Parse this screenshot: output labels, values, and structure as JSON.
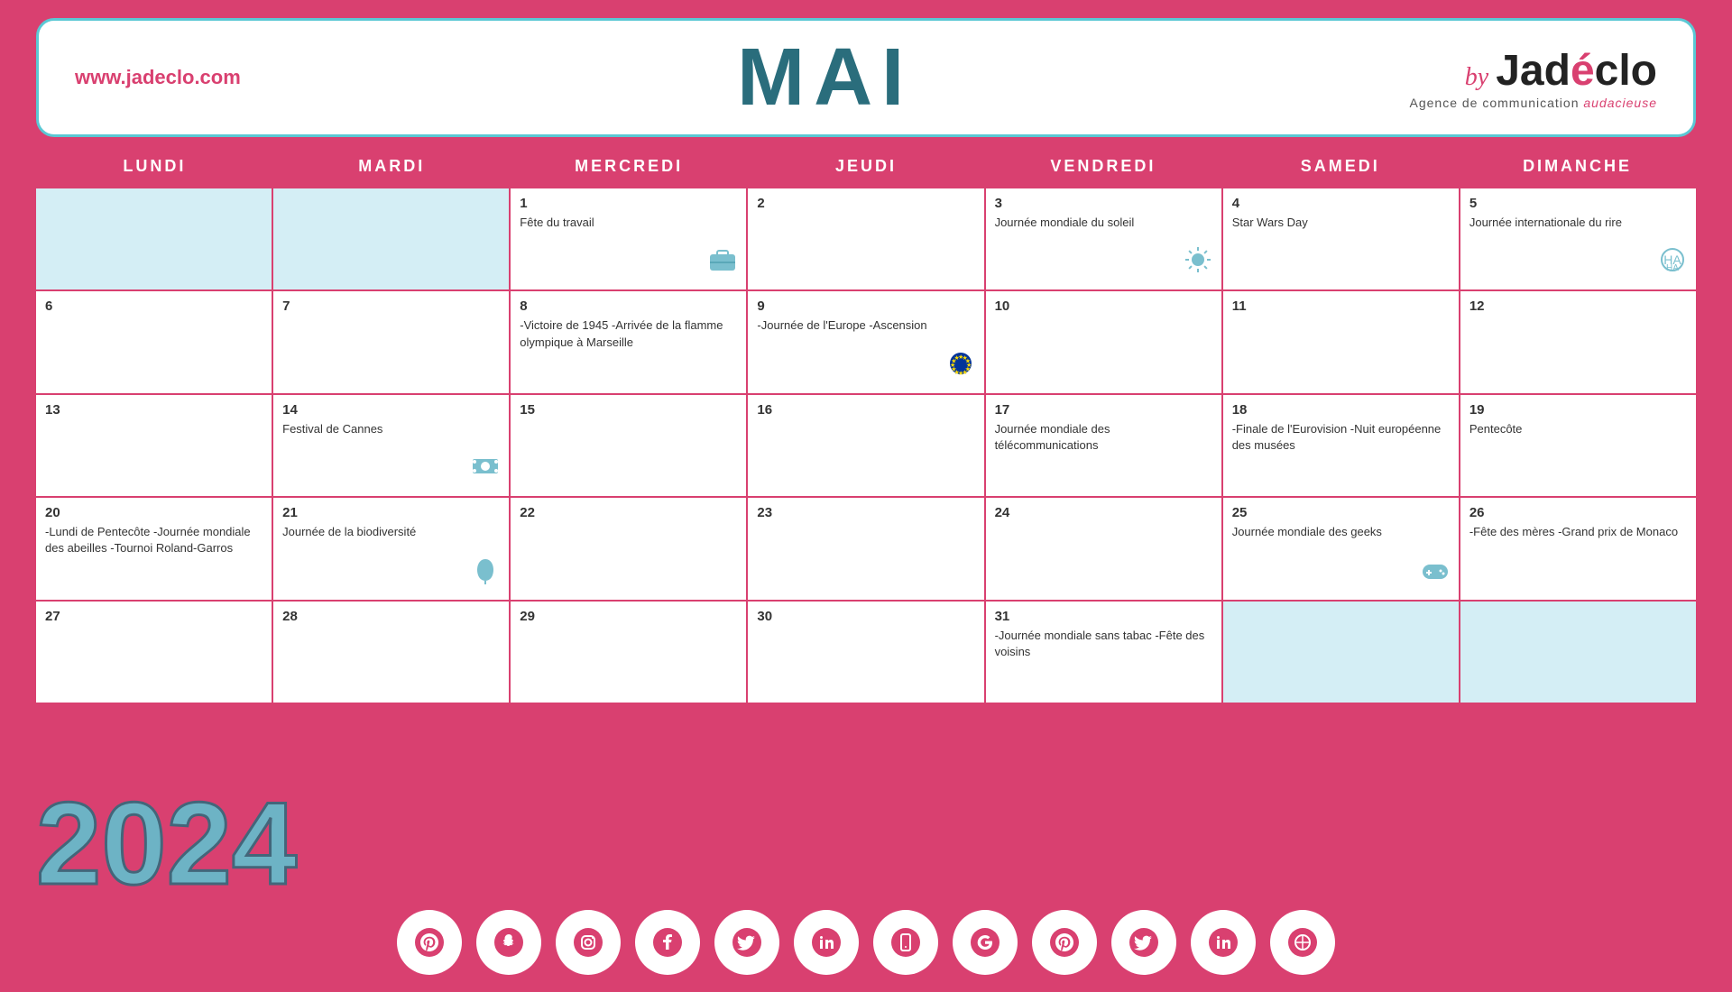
{
  "header": {
    "website": "www.jadeclo.com",
    "month": "MAI",
    "logo_by": "by",
    "logo_name": "Jadéclo",
    "logo_accent": "é",
    "logo_subtitle": "Agence de communication",
    "logo_subtitle_accent": "audacieuse"
  },
  "days": {
    "headers": [
      "LUNDI",
      "MARDI",
      "MERCREDI",
      "JEUDI",
      "VENDREDI",
      "SAMEDI",
      "DIMANCHE"
    ]
  },
  "cells": [
    {
      "day": "",
      "event": "",
      "empty": true
    },
    {
      "day": "",
      "event": "",
      "empty": true
    },
    {
      "day": "1",
      "event": "Fête du travail",
      "icon": "briefcase"
    },
    {
      "day": "2",
      "event": ""
    },
    {
      "day": "3",
      "event": "Journée mondiale\ndu soleil",
      "icon": "sun"
    },
    {
      "day": "4",
      "event": "Star Wars Day"
    },
    {
      "day": "5",
      "event": "Journée internationale\ndu rire",
      "icon": "laugh"
    },
    {
      "day": "6",
      "event": ""
    },
    {
      "day": "7",
      "event": ""
    },
    {
      "day": "8",
      "event": "-Victoire de 1945\n-Arrivée de la flamme\nolympique à Marseille"
    },
    {
      "day": "9",
      "event": "-Journée de l'Europe\n-Ascension",
      "icon": "eu"
    },
    {
      "day": "10",
      "event": ""
    },
    {
      "day": "11",
      "event": ""
    },
    {
      "day": "12",
      "event": ""
    },
    {
      "day": "13",
      "event": ""
    },
    {
      "day": "14",
      "event": "Festival de\nCannes",
      "icon": "film"
    },
    {
      "day": "15",
      "event": ""
    },
    {
      "day": "16",
      "event": ""
    },
    {
      "day": "17",
      "event": "Journée\nmondiale des\ntélécommunications"
    },
    {
      "day": "18",
      "event": "-Finale de l'Eurovision\n-Nuit européenne des\nmusées"
    },
    {
      "day": "19",
      "event": "Pentecôte"
    },
    {
      "day": "20",
      "event": "-Lundi de Pentecôte\n-Journée mondiale\ndes abeilles\n-Tournoi Roland-Garros"
    },
    {
      "day": "21",
      "event": "Journée de la\nbiodiversité",
      "icon": "leaf"
    },
    {
      "day": "22",
      "event": ""
    },
    {
      "day": "23",
      "event": ""
    },
    {
      "day": "24",
      "event": ""
    },
    {
      "day": "25",
      "event": "Journée mondiale\ndes geeks",
      "icon": "gamepad"
    },
    {
      "day": "26",
      "event": "-Fête des mères\n-Grand prix de\nMonaco"
    },
    {
      "day": "27",
      "event": ""
    },
    {
      "day": "28",
      "event": ""
    },
    {
      "day": "29",
      "event": ""
    },
    {
      "day": "30",
      "event": ""
    },
    {
      "day": "31",
      "event": "-Journée mondiale\nsans tabac\n-Fête des voisins"
    },
    {
      "day": "",
      "event": "",
      "empty_end": true
    },
    {
      "day": "",
      "event": "",
      "empty_end": true
    }
  ],
  "year": "2024",
  "social_icons": [
    "pinterest",
    "snapchat",
    "instagram",
    "facebook",
    "twitter",
    "linkedin",
    "mobile",
    "google",
    "pinterest2",
    "twitter2",
    "linkedin2",
    "circle"
  ]
}
